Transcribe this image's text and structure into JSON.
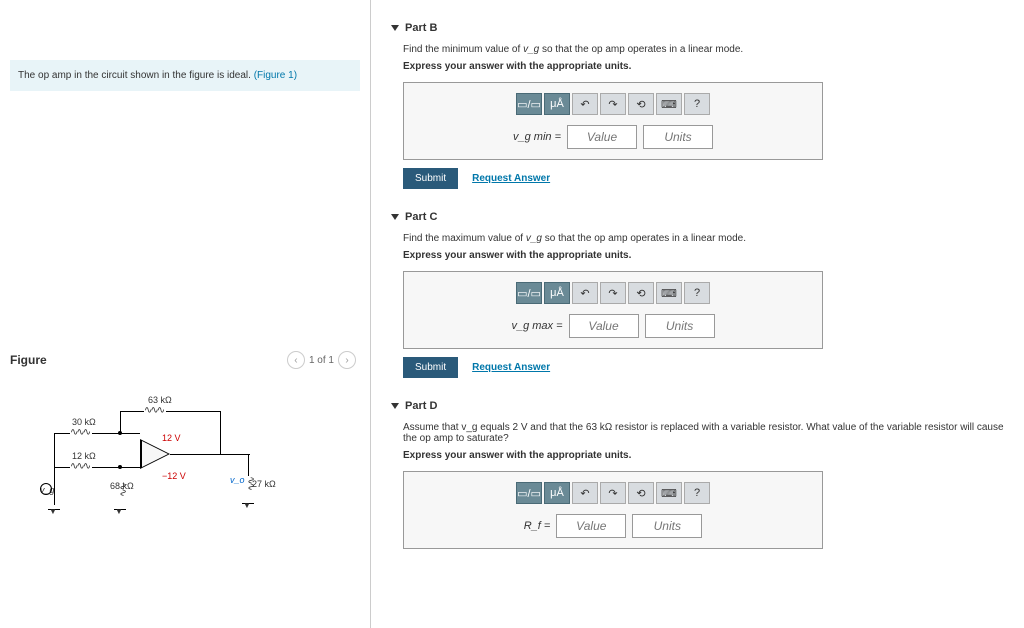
{
  "intro": {
    "text": "The op amp in the circuit shown in the figure is ideal. ",
    "link": "(Figure 1)"
  },
  "figure": {
    "title": "Figure",
    "pager": "1 of 1"
  },
  "circuit": {
    "r_top": "63 kΩ",
    "r_upper_left": "30 kΩ",
    "r_lower_left": "12 kΩ",
    "r_vert": "68 kΩ",
    "r_out": "27 kΩ",
    "v_plus": "12 V",
    "v_minus": "−12 V",
    "vg": "v_g",
    "vo": "v_o"
  },
  "parts": {
    "b": {
      "title": "Part B",
      "instr_pre": "Find the minimum value of ",
      "instr_var": "v_g",
      "instr_post": " so that the op amp operates in a linear mode.",
      "express": "Express your answer with the appropriate units.",
      "var_label": "v_g min =",
      "value_ph": "Value",
      "units_ph": "Units",
      "submit": "Submit",
      "request": "Request Answer"
    },
    "c": {
      "title": "Part C",
      "instr_pre": "Find the maximum value of ",
      "instr_var": "v_g",
      "instr_post": " so that the op amp operates in a linear mode.",
      "express": "Express your answer with the appropriate units.",
      "var_label": "v_g max =",
      "value_ph": "Value",
      "units_ph": "Units",
      "submit": "Submit",
      "request": "Request Answer"
    },
    "d": {
      "title": "Part D",
      "instr": "Assume that v_g equals 2 V and that the 63 kΩ resistor is replaced with a variable resistor. What value of the variable resistor will cause the op amp to saturate?",
      "express": "Express your answer with the appropriate units.",
      "var_label": "R_f =",
      "value_ph": "Value",
      "units_ph": "Units"
    }
  },
  "toolbar": {
    "templates": "▭/▭",
    "units": "μÅ",
    "undo": "↶",
    "redo": "↷",
    "reset": "⟲",
    "keyboard": "⌨",
    "help": "?"
  }
}
